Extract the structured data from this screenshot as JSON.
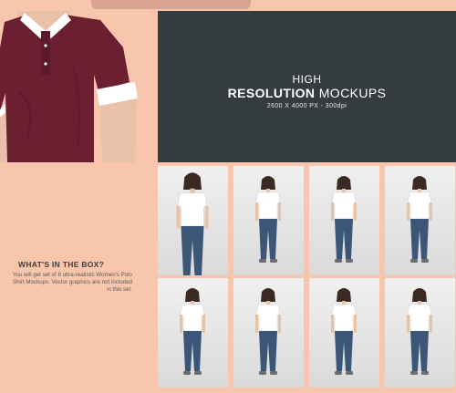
{
  "hero": {
    "line1": "HIGH",
    "line2_bold": "RESOLUTION",
    "line2_rest": " MOCKUPS",
    "line3": "2600 X 4000 PX - 300dpi"
  },
  "info": {
    "heading": "WHAT'S IN THE BOX?",
    "body": "You will get set of 8 ultra-realistic Women's Polo Shirt Mockups. Vector graphics are not included in this set."
  },
  "colors": {
    "background": "#f8c6ad",
    "dark_panel": "#353c3e",
    "shirt_maroon": "#6d1f32",
    "jeans": "#3b5677",
    "skin": "#e9c0a8"
  }
}
